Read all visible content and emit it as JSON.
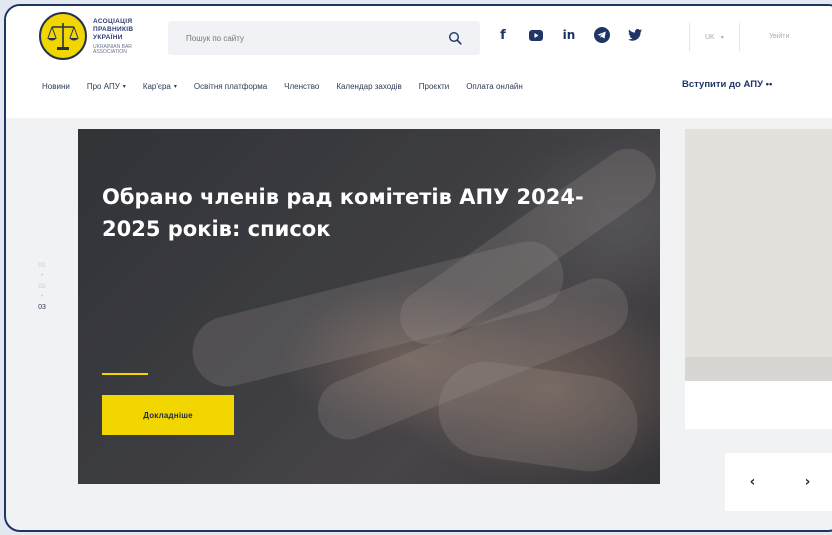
{
  "logo": {
    "title": "АСОЦІАЦІЯ ПРАВНИКІВ УКРАЇНИ",
    "subtitle": "UKRAINIAN BAR ASSOCIATION"
  },
  "search": {
    "placeholder": "Пошук по сайту"
  },
  "social": {
    "facebook": "f",
    "linkedin": "in"
  },
  "header": {
    "lang": "UK",
    "lang_caret": "▾",
    "login": "Увійти"
  },
  "nav": {
    "items": [
      {
        "label": "Новини"
      },
      {
        "label": "Про АПУ",
        "caret": "▾"
      },
      {
        "label": "Кар'єра",
        "caret": "▾"
      },
      {
        "label": "Освітня платформа"
      },
      {
        "label": "Членство"
      },
      {
        "label": "Календар заходів"
      },
      {
        "label": "Проєкти"
      },
      {
        "label": "Оплата онлайн"
      }
    ],
    "join": "Вступити до АПУ ••"
  },
  "slider": {
    "numbers": [
      "01",
      "02",
      "03"
    ],
    "active": "03",
    "dot": "•"
  },
  "hero": {
    "title": "Обрано членів рад комітетів АПУ 2024-2025 років: список",
    "button": "Докладніше"
  },
  "arrows": {
    "prev": "‹",
    "next": "›"
  },
  "colors": {
    "accent": "#f2d600",
    "brand": "#1f3566"
  }
}
